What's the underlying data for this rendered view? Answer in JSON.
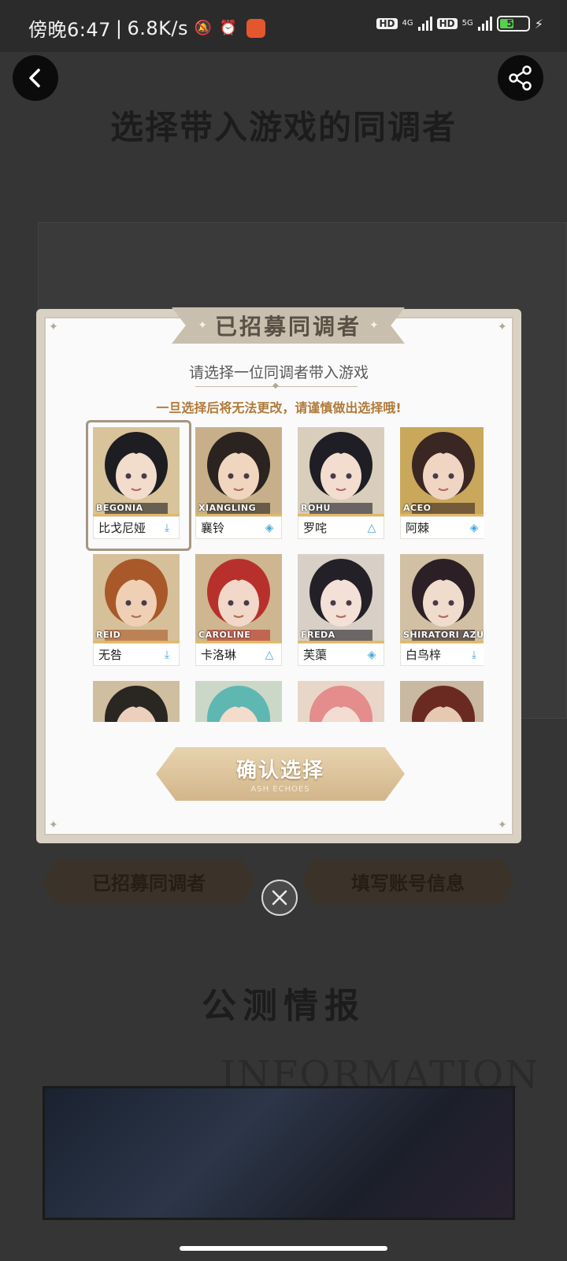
{
  "status_bar": {
    "time": "傍晚6:47",
    "speed": "6.8K/s",
    "hd1": "HD",
    "net1": "4G",
    "hd2": "HD",
    "net2": "5G",
    "battery": "51",
    "battery_level": 0.51
  },
  "background": {
    "page_title": "选择带入游戏的同调者",
    "tab_recruited": "已招募同调者",
    "tab_account": "填写账号信息",
    "section_title": "公测情报",
    "section_en": "INFORMATION"
  },
  "modal": {
    "header": "已招募同调者",
    "subtitle": "请选择一位同调者带入游戏",
    "warning": "一旦选择后将无法更改，请谨慎做出选择哦!",
    "confirm_label": "确认选择",
    "confirm_sub": "ASH ECHOES",
    "characters": [
      {
        "en": "BEGONIA",
        "cn": "比戈尼娅",
        "icon": "download-role-icon"
      },
      {
        "en": "XIANGLING",
        "cn": "襄铃",
        "icon": "diamond-role-icon"
      },
      {
        "en": "ROHU",
        "cn": "罗咤",
        "icon": "triangle-role-icon"
      },
      {
        "en": "ACEO",
        "cn": "阿棘",
        "icon": "diamond-role-icon"
      },
      {
        "en": "REID",
        "cn": "无咎",
        "icon": "download-role-icon"
      },
      {
        "en": "CAROLINE",
        "cn": "卡洛琳",
        "icon": "triangle-role-icon"
      },
      {
        "en": "FREDA",
        "cn": "芙蕖",
        "icon": "diamond-role-icon"
      },
      {
        "en": "SHIRATORI AZUSA",
        "cn": "白鸟梓",
        "icon": "download-role-icon"
      },
      {
        "en": "",
        "cn": "",
        "icon": ""
      },
      {
        "en": "",
        "cn": "",
        "icon": ""
      },
      {
        "en": "",
        "cn": "",
        "icon": ""
      },
      {
        "en": "",
        "cn": "",
        "icon": ""
      }
    ]
  }
}
